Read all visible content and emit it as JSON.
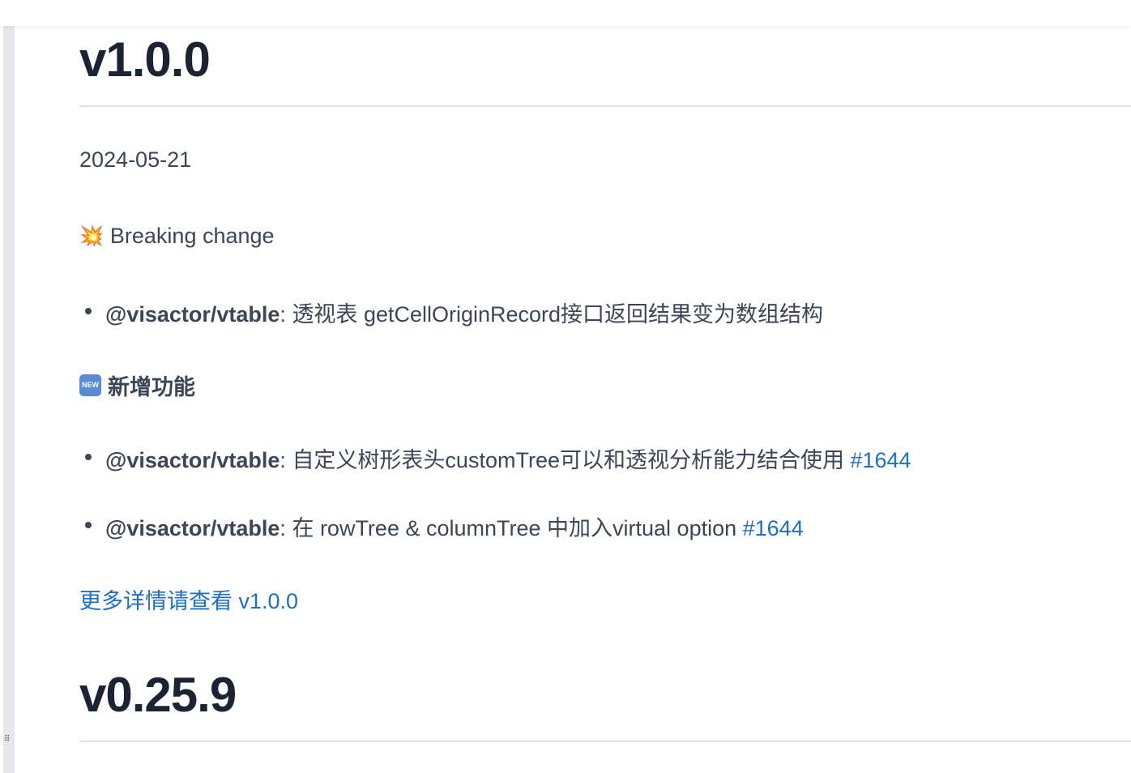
{
  "releases": [
    {
      "version": "v1.0.0",
      "date": "2024-05-21",
      "breaking": {
        "title": "Breaking change",
        "items": [
          {
            "pkg": "@visactor/vtable",
            "text": "透视表 getCellOriginRecord接口返回结果变为数组结构"
          }
        ]
      },
      "features": {
        "title": "新增功能",
        "items": [
          {
            "pkg": "@visactor/vtable",
            "text": "自定义树形表头customTree可以和透视分析能力结合使用 ",
            "link": "#1644"
          },
          {
            "pkg": "@visactor/vtable",
            "text": "在 rowTree & columnTree 中加入virtual option ",
            "link": "#1644"
          }
        ]
      },
      "more_link": "更多详情请查看 v1.0.0"
    },
    {
      "version": "v0.25.9"
    }
  ],
  "icons": {
    "breaking": "collision-icon",
    "features": "new-badge-icon",
    "new_badge_text": "NEW"
  }
}
